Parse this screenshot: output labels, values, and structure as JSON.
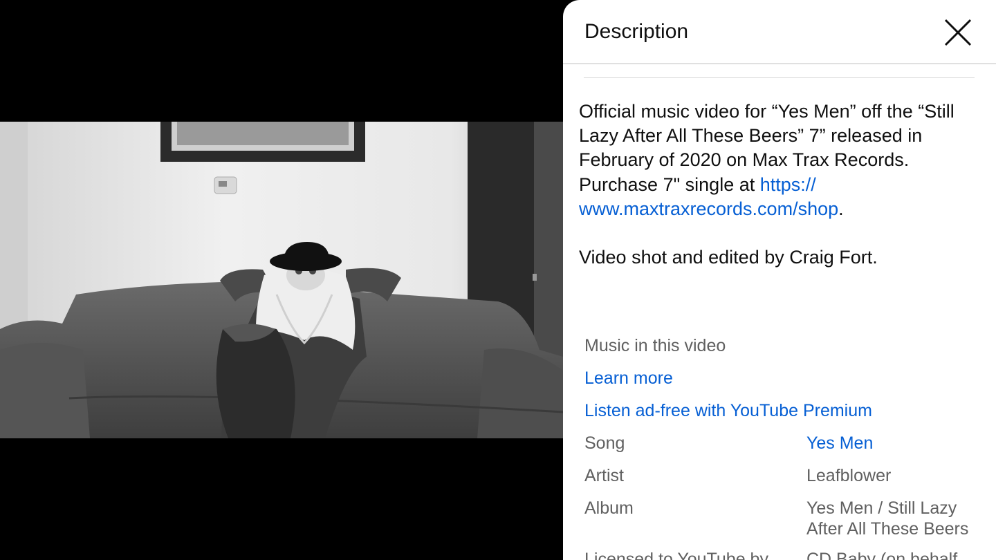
{
  "panel": {
    "title": "Description",
    "close_icon": "close-icon"
  },
  "description": {
    "line1_text": "Official music video for “Yes Men” off the “Still Lazy After All These Beers” 7” released in February of 2020 on Max Trax Records. Purchase 7\" single at ",
    "link_text": "https://​www.maxtraxrecords.com/shop",
    "link_after": ".",
    "credits": "Video shot and edited by Craig Fort."
  },
  "music": {
    "heading": "Music in this video",
    "learn_more": "Learn more",
    "premium_link": "Listen ad-free with YouTube Premium",
    "rows": [
      {
        "label": "Song",
        "value": "Yes Men",
        "is_link": true
      },
      {
        "label": "Artist",
        "value": "Leafblower",
        "is_link": false
      },
      {
        "label": "Album",
        "value": "Yes Men / Still Lazy After All These Beers",
        "is_link": false
      },
      {
        "label": "Licensed to YouTube by",
        "value": "CD Baby (on behalf",
        "is_link": false
      }
    ]
  },
  "colors": {
    "link": "#065fd4",
    "secondary_text": "#606060",
    "primary_text": "#0f0f0f"
  }
}
